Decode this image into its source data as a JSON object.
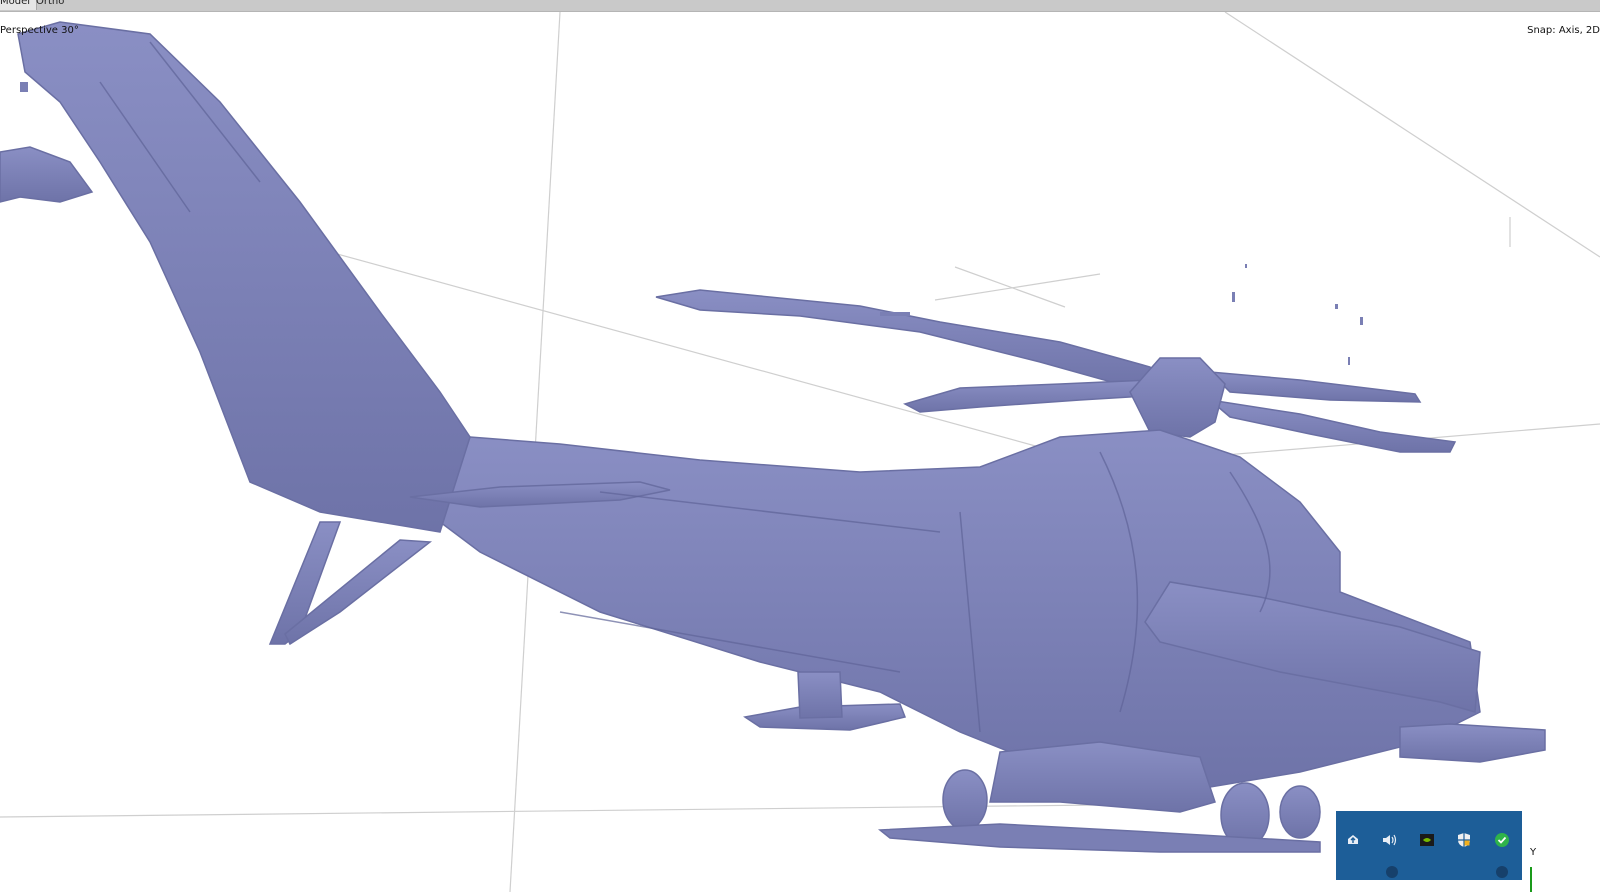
{
  "toolbar": {
    "tabs": [
      {
        "label": "Model"
      },
      {
        "label": "Ortho"
      }
    ]
  },
  "viewport": {
    "projection_label": "Perspective 30°",
    "snap_label": "Snap: Axis, 2D",
    "axis_label": "Y",
    "mesh_color": "#8388bd",
    "mesh_shadow_color": "#5f6498",
    "grid_color": "#cfcfcf"
  },
  "taskbar_tray": {
    "background": "#1d5e98",
    "icons": [
      {
        "name": "cloud-upload-icon"
      },
      {
        "name": "speaker-icon"
      },
      {
        "name": "nvidia-icon"
      },
      {
        "name": "shield-icon"
      },
      {
        "name": "check-icon"
      }
    ]
  }
}
